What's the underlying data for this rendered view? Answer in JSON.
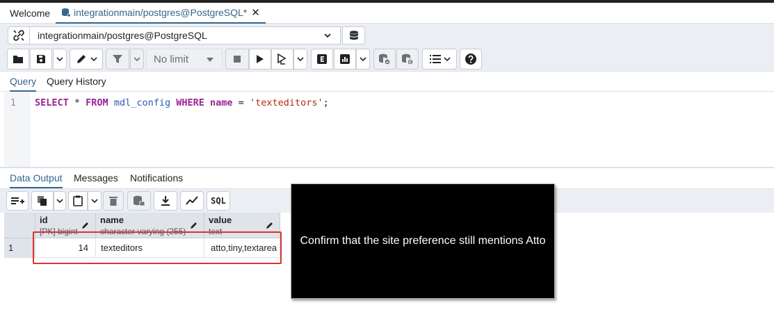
{
  "tabs": {
    "welcome_label": "Welcome",
    "active_label": "integrationmain/postgres@PostgreSQL*"
  },
  "connection": {
    "selected": "integrationmain/postgres@PostgreSQL"
  },
  "toolbar": {
    "limit_label": "No limit"
  },
  "query_tabs": {
    "query": "Query",
    "history": "Query History"
  },
  "editor": {
    "line_number": "1",
    "tokens": {
      "select": "SELECT",
      "star": " * ",
      "from": "FROM",
      "table": "mdl_config",
      "where": "WHERE",
      "column": "name",
      "eq": " = ",
      "value": "'texteditors'",
      "semicolon": ";"
    }
  },
  "output_tabs": {
    "data_output": "Data Output",
    "messages": "Messages",
    "notifications": "Notifications"
  },
  "output_toolbar": {
    "sql_label": "SQL"
  },
  "grid": {
    "columns": [
      {
        "name": "id",
        "type": "[PK] bigint"
      },
      {
        "name": "name",
        "type": "character varying (255)"
      },
      {
        "name": "value",
        "type": "text"
      }
    ],
    "rows": [
      {
        "rownum": "1",
        "id": "14",
        "name": "texteditors",
        "value": "atto,tiny,textarea"
      }
    ]
  },
  "overlay": {
    "message": "Confirm that the site preference still mentions Atto"
  },
  "colors": {
    "accent": "#326690",
    "highlight_border": "#d9332f",
    "keyword": "#9b2393",
    "string": "#b3280e"
  }
}
